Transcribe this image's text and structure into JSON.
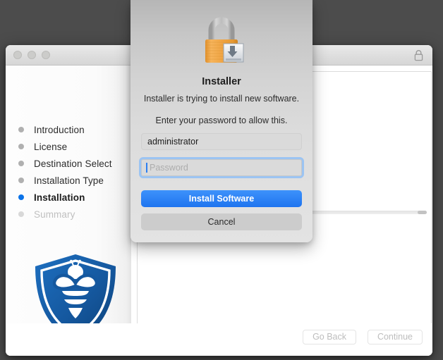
{
  "window": {
    "traffic_lights": [
      "close",
      "minimize",
      "zoom"
    ],
    "titlebar_lock_icon": "lock-icon"
  },
  "sidebar": {
    "steps": [
      {
        "label": "Introduction",
        "state": "done"
      },
      {
        "label": "License",
        "state": "done"
      },
      {
        "label": "Destination Select",
        "state": "done"
      },
      {
        "label": "Installation Type",
        "state": "done"
      },
      {
        "label": "Installation",
        "state": "current"
      },
      {
        "label": "Summary",
        "state": "upcoming"
      }
    ],
    "logo_name": "malwarebytes-bee-shield-logo"
  },
  "bottom_bar": {
    "go_back_label": "Go Back",
    "continue_label": "Continue"
  },
  "dialog": {
    "icon_name": "padlock-install-icon",
    "app_title": "Installer",
    "message": "Installer is trying to install new software.",
    "prompt": "Enter your password to allow this.",
    "username_value": "administrator",
    "password_placeholder": "Password",
    "install_label": "Install Software",
    "cancel_label": "Cancel"
  },
  "colors": {
    "accent_blue": "#2e83f5",
    "current_step_blue": "#0a72e8",
    "focus_ring_blue": "#9cc4f2",
    "desktop_gray": "#4c4c4c",
    "shield_blue": "#1a5fa8"
  }
}
